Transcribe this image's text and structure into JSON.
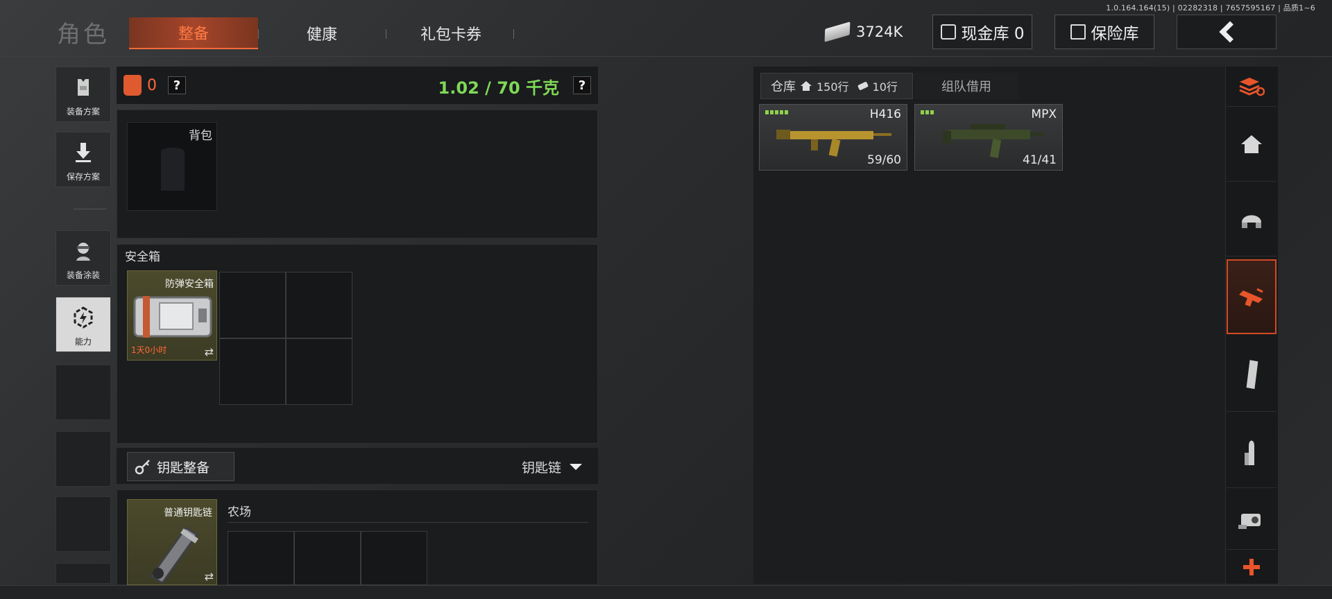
{
  "version": "1.0.164.164(15) | 02282318 | 7657595167 | 品质1~6",
  "header": {
    "title": "角色",
    "tabs": [
      {
        "label": "整备",
        "active": true
      },
      {
        "label": "健康",
        "active": false
      },
      {
        "label": "礼包卡券",
        "active": false
      }
    ],
    "money": "3724K",
    "cash_vault_label": "现金库 0",
    "safe_label": "保险库"
  },
  "sidebar": {
    "items": [
      {
        "label": "装备方案",
        "icon": "vest-icon"
      },
      {
        "label": "保存方案",
        "icon": "download-icon"
      },
      {
        "label": "装备涂装",
        "icon": "soldier-icon"
      },
      {
        "label": "能力",
        "icon": "ability-icon"
      }
    ]
  },
  "loadout": {
    "armor_count": "0",
    "help": "?",
    "weight": "1.02 / 70 千克",
    "backpack_label": "背包",
    "safebox": {
      "title": "安全箱",
      "item_name": "防弹安全箱",
      "timer": "1天0小时",
      "swap": "⇄"
    },
    "keys": {
      "button_label": "钥匙整备",
      "chain_label": "钥匙链",
      "item_name": "普通钥匙链",
      "slot_label": "农场",
      "swap": "⇄"
    }
  },
  "warehouse": {
    "tab_label": "仓库",
    "rows_home": "150行",
    "rows_ticket": "10行",
    "team_tab": "组队借用",
    "items": [
      {
        "name": "H416",
        "ammo": "59/60",
        "rarity_bars": 5
      },
      {
        "name": "MPX",
        "ammo": "41/41",
        "rarity_bars": 3
      }
    ]
  },
  "rail": {
    "icons": [
      "stack-icon",
      "home-icon",
      "helmet-icon",
      "weapon-category-icon",
      "magazine-icon",
      "ammo-icon",
      "scope-icon",
      "plus-icon"
    ],
    "active_index": 3,
    "accent": "#e8552b"
  },
  "colors": {
    "accent": "#ff6a3a",
    "weight_green": "#7ed957",
    "rarity_green": "#8fd14f"
  }
}
